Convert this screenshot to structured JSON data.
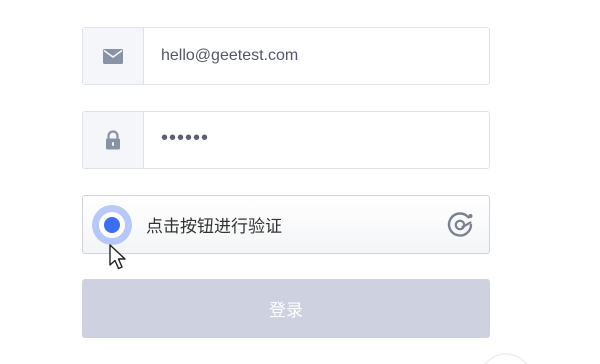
{
  "form": {
    "email": {
      "icon": "envelope-icon",
      "value": "hello@geetest.com"
    },
    "password": {
      "icon": "lock-icon",
      "value": "••••••"
    },
    "captcha": {
      "tip": "点击按钮进行验证",
      "logo_icon": "geetest-logo-icon",
      "accent_color": "#3d6ef0"
    },
    "submit_label": "登录"
  },
  "colors": {
    "border": "#dfe2ea",
    "icon_cell_bg": "#f4f6fa",
    "submit_disabled_bg": "#cdd1e0"
  }
}
